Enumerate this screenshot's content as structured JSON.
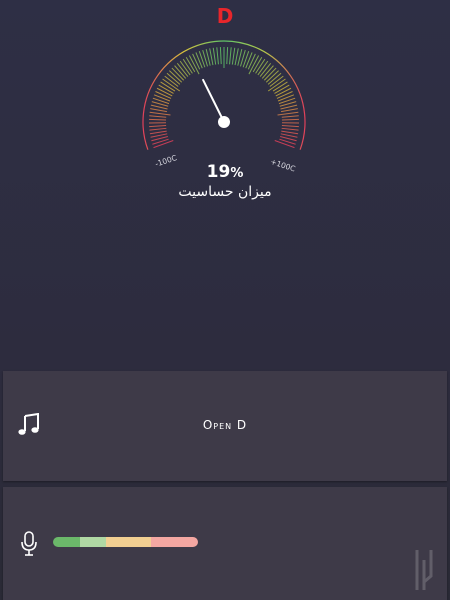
{
  "note": "D",
  "gauge": {
    "min_label": "-100C",
    "max_label": "+100C",
    "percent_value": "19",
    "percent_symbol": "%",
    "sensitivity_label": "میزان حساسیت",
    "needle_fraction": 0.38
  },
  "tuning": {
    "name": "Open D",
    "icon": "music-note-icon"
  },
  "mic": {
    "icon": "microphone-icon",
    "level_colors": [
      "#6bb86a",
      "#b0d8a4",
      "#f2cf92",
      "#f4a7a2"
    ]
  },
  "colors": {
    "note": "#e8262b",
    "panel": "#3e3a48",
    "text": "#ffffff"
  }
}
